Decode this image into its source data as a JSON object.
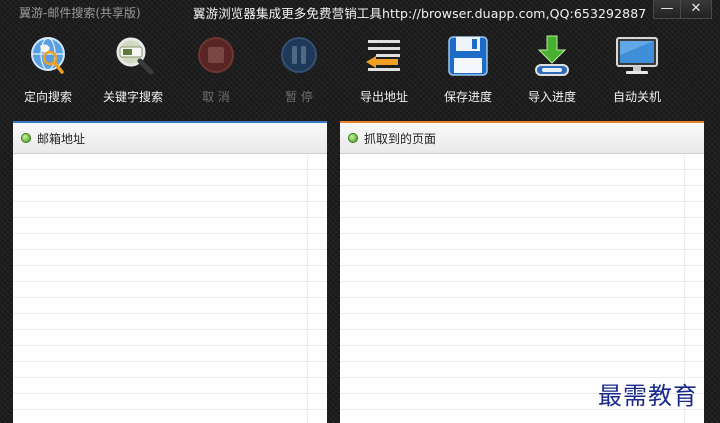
{
  "window": {
    "app_title": "翼游-邮件搜索(共享版)",
    "ad_text": "翼游浏览器集成更多免费营销工具http://browser.duapp.com,QQ:653292887",
    "minimize_glyph": "—",
    "close_glyph": "✕"
  },
  "toolbar": {
    "items": [
      {
        "label": "定向搜索",
        "icon": "globe-search-icon",
        "enabled": true
      },
      {
        "label": "关键字搜索",
        "icon": "magnifier-icon",
        "enabled": true
      },
      {
        "label": "取 消",
        "icon": "stop-icon",
        "enabled": false
      },
      {
        "label": "暂 停",
        "icon": "pause-icon",
        "enabled": false
      },
      {
        "label": "导出地址",
        "icon": "export-icon",
        "enabled": true
      },
      {
        "label": "保存进度",
        "icon": "save-icon",
        "enabled": true
      },
      {
        "label": "导入进度",
        "icon": "import-icon",
        "enabled": true
      },
      {
        "label": "自动关机",
        "icon": "monitor-icon",
        "enabled": true
      }
    ]
  },
  "panels": {
    "left": {
      "title": "邮箱地址",
      "accent": "#3a78c4"
    },
    "right": {
      "title": "抓取到的页面",
      "accent": "#e8822c"
    }
  },
  "watermark": "最需教育"
}
